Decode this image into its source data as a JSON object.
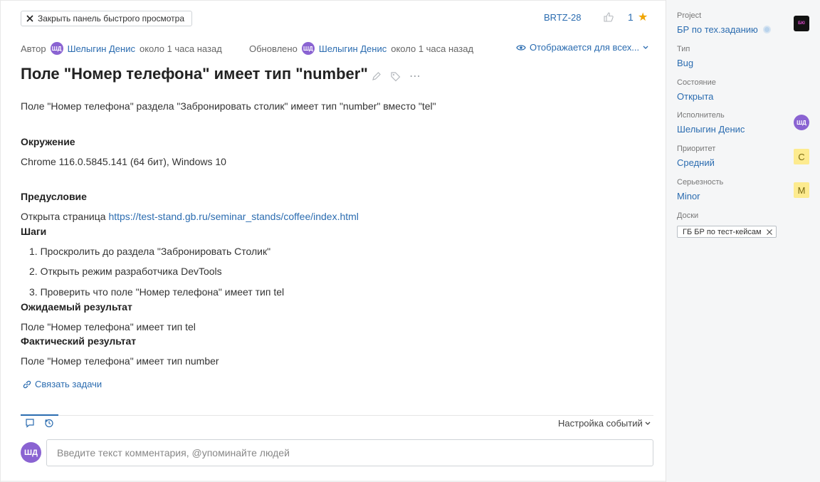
{
  "header": {
    "close_label": "Закрыть панель быстрого просмотра",
    "issue_key": "BRTZ-28",
    "likes": "1",
    "author_label": "Автор",
    "author_initials": "ШД",
    "author_name": "Шелыгин Денис",
    "author_time": "около 1 часа назад",
    "updated_label": "Обновлено",
    "updated_initials": "ШД",
    "updated_name": "Шелыгин Денис",
    "updated_time": "около 1 часа назад",
    "visibility": "Отображается для всех..."
  },
  "issue": {
    "title": "Поле \"Номер телефона\" имеет тип \"number\"",
    "summary": "Поле \"Номер телефона\" раздела \"Забронировать столик\" имеет тип \"number\" вместо \"tel\"",
    "env_heading": "Окружение",
    "env_text": "Chrome 116.0.5845.141 (64 бит), Windows 10",
    "pre_heading": "Предусловие",
    "pre_text": "Открыта страница ",
    "pre_link": "https://test-stand.gb.ru/seminar_stands/coffee/index.html",
    "steps_heading": "Шаги",
    "steps": [
      "1. Проскролить до раздела \"Забронировать Столик\"",
      "2. Открыть режим разработчика DevTools",
      "3. Проверить что поле \"Номер телефона\" имеет тип tel"
    ],
    "expected_heading": "Ожидаемый результат",
    "expected_text": "Поле \"Номер телефона\" имеет тип tel",
    "actual_heading": "Фактический результат",
    "actual_text": "Поле \"Номер телефона\" имеет тип number",
    "link_tasks": "Связать задачи"
  },
  "activity": {
    "events_label": "Настройка событий",
    "commenter_initials": "ШД",
    "comment_placeholder": "Введите текст комментария, @упоминайте людей"
  },
  "fields": {
    "project_label": "Project",
    "project_value": "БР по тех.заданию",
    "project_logo_text": "БКI",
    "type_label": "Тип",
    "type_value": "Bug",
    "status_label": "Состояние",
    "status_value": "Открыта",
    "assignee_label": "Исполнитель",
    "assignee_value": "Шелыгин Денис",
    "assignee_initials": "ШД",
    "priority_label": "Приоритет",
    "priority_value": "Средний",
    "priority_badge": "С",
    "severity_label": "Серьезность",
    "severity_value": "Minor",
    "severity_badge": "M",
    "boards_label": "Доски",
    "board_value": "ГБ БР по тест-кейсам"
  },
  "colors": {
    "accent": "#2b6cb0",
    "avatar": "#8a63d2",
    "star": "#f0a500",
    "badge_bg": "#fdeb8f"
  }
}
